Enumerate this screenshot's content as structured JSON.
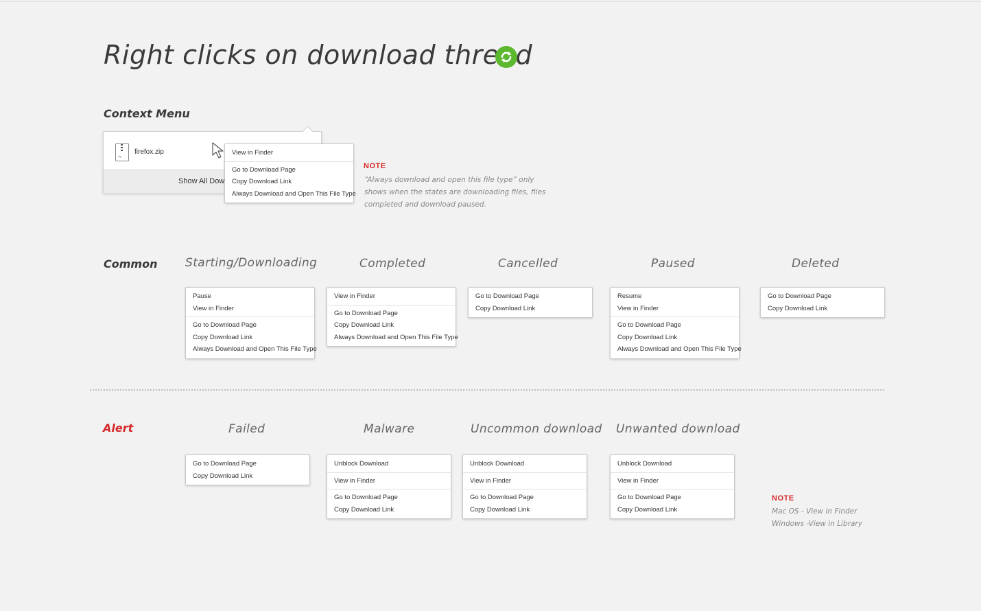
{
  "title": "Right clicks on download thread",
  "icons": {
    "sync": "sync-refresh-icon",
    "file": "zip-file-icon",
    "cursor": "mouse-pointer-icon"
  },
  "colors": {
    "accent_green": "#5cb82e",
    "alert_red": "#d62828"
  },
  "context_menu": {
    "heading": "Context Menu",
    "panel": {
      "file_name": "firefox.zip",
      "footer_label": "Show All Dow"
    },
    "menu_groups": [
      [
        "View in Finder"
      ],
      [
        "Go to Download Page",
        "Copy Download Link",
        "Always Download and Open This File Type"
      ]
    ],
    "note": {
      "title": "NOTE",
      "lines": [
        "“Always download and open this file type” only",
        "shows when the states are downloading files, files",
        "completed and download paused."
      ]
    }
  },
  "common": {
    "label": "Common",
    "columns": [
      {
        "heading": "Starting/Downloading",
        "groups": [
          [
            "Pause",
            "View in Finder"
          ],
          [
            "Go to Download Page",
            "Copy Download Link",
            "Always Download and Open This File Type"
          ]
        ]
      },
      {
        "heading": "Completed",
        "groups": [
          [
            "View in Finder"
          ],
          [
            "Go to Download Page",
            "Copy Download Link",
            "Always Download and Open This File Type"
          ]
        ]
      },
      {
        "heading": "Cancelled",
        "groups": [
          [
            "Go to Download Page",
            "Copy Download Link"
          ]
        ]
      },
      {
        "heading": "Paused",
        "groups": [
          [
            "Resume",
            "View in Finder"
          ],
          [
            "Go to Download Page",
            "Copy Download Link",
            "Always Download and Open This File Type"
          ]
        ]
      },
      {
        "heading": "Deleted",
        "groups": [
          [
            "Go to Download Page",
            "Copy Download Link"
          ]
        ]
      }
    ]
  },
  "alert": {
    "label": "Alert",
    "columns": [
      {
        "heading": "Failed",
        "groups": [
          [
            "Go to Download Page",
            "Copy Download Link"
          ]
        ]
      },
      {
        "heading": "Malware",
        "groups": [
          [
            "Unblock Download"
          ],
          [
            "View in Finder"
          ],
          [
            "Go to Download Page",
            "Copy Download Link"
          ]
        ]
      },
      {
        "heading": "Uncommon download",
        "groups": [
          [
            "Unblock Download"
          ],
          [
            "View in Finder"
          ],
          [
            "Go to Download Page",
            "Copy Download Link"
          ]
        ]
      },
      {
        "heading": "Unwanted download",
        "groups": [
          [
            "Unblock Download"
          ],
          [
            "View in Finder"
          ],
          [
            "Go to Download Page",
            "Copy Download Link"
          ]
        ]
      }
    ],
    "note": {
      "title": "NOTE",
      "lines": [
        "Mac OS - View in Finder",
        "Windows -View in Library"
      ]
    }
  }
}
